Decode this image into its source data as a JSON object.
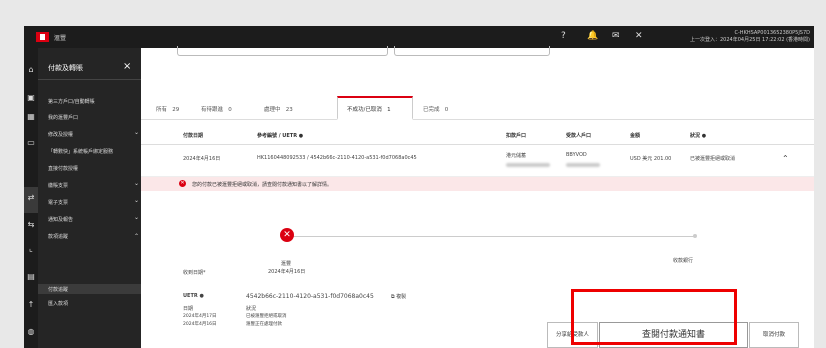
{
  "topbar": {
    "brand": "滙豐",
    "icons": [
      "help-icon",
      "bell-icon",
      "mail-icon",
      "tools-icon"
    ],
    "icon_glyphs": [
      "?",
      "🔔",
      "✉",
      "✕"
    ],
    "user_line1": "C-HKHSAP0013652380P5JS7D",
    "user_line2": "上一次登入：2024年04月25日 17:22:02 (香港時間)"
  },
  "sidebar": {
    "title": "付款及轉賬",
    "close": "×",
    "items": [
      {
        "label": "第三方戶口/自動轉賬",
        "chev": ""
      },
      {
        "label": "我的滙豐戶口",
        "chev": ""
      },
      {
        "label": "修改及授權",
        "chev": "⌄"
      },
      {
        "label": "「轉數快」系統帳戶綁定服務",
        "chev": ""
      },
      {
        "label": "直接付款授權",
        "chev": ""
      },
      {
        "label": "繳賬支票",
        "chev": "⌄"
      },
      {
        "label": "電子支票",
        "chev": "⌄"
      },
      {
        "label": "通知及報告",
        "chev": "⌄"
      },
      {
        "label": "款項追蹤",
        "chev": "⌃"
      },
      {
        "label": "付款追蹤",
        "chev": ""
      },
      {
        "label": "匯入款項",
        "chev": ""
      }
    ]
  },
  "tabs": [
    {
      "label": "所有",
      "count": "29"
    },
    {
      "label": "有待跟進",
      "count": "0"
    },
    {
      "label": "處理中",
      "count": "23"
    },
    {
      "label": "不成功/已取消",
      "count": "1"
    },
    {
      "label": "已完成",
      "count": "0"
    }
  ],
  "table": {
    "headers": [
      "付款日期",
      "參考編號 / UETR",
      "扣款戶口",
      "受款人戶口",
      "金額",
      "狀況"
    ],
    "row": {
      "date": "2024年4月16日",
      "ref": "HK1160448092533 / 4542b66c-2110-4120-a531-f0d7068a0c45",
      "from": "港元儲蓄",
      "to": "BBYVOD",
      "amount": "USD 美元  201.00",
      "status": "已被滙豐拒絕或取消"
    }
  },
  "alert": "您的付款已被滙豐拒絕或取消，請查閱付款通知書以了解詳情。",
  "tracker": {
    "left_label": "收到日期*",
    "stage": "滙豐",
    "stage_date": "2024年4月16日",
    "end_label": "收款銀行"
  },
  "details": {
    "uetr_label": "UETR",
    "uetr": "4542b66c-2110-4120-a531-f0d7068a0c45",
    "copy": "複製",
    "date_h": "日期",
    "status_h": "狀況",
    "rows": [
      {
        "date": "2024年4月17日",
        "status": "已被滙豐拒絕或取消"
      },
      {
        "date": "2024年4月16日",
        "status": "滙豐正在處理付款"
      }
    ]
  },
  "buttons": {
    "share": "分享給受款人",
    "view": "查閱付款通知書",
    "cancel": "取消付款"
  },
  "colors": {
    "brand": "#db0011",
    "highlight": "#e00000"
  }
}
